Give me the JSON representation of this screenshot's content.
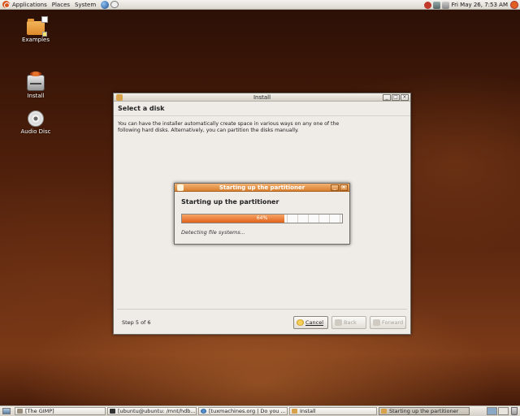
{
  "top_panel": {
    "menus": [
      "Applications",
      "Places",
      "System"
    ],
    "clock": "Fri May 26,  7:53 AM"
  },
  "desktop_icons": [
    {
      "label": "Examples"
    },
    {
      "label": "Install"
    },
    {
      "label": "Audio Disc"
    }
  ],
  "install_window": {
    "title": "Install",
    "heading": "Select a disk",
    "description": "You can have the installer automatically create space in various ways on any one of the following hard disks. Alternatively, you can partition the disks manually.",
    "step": "Step 5 of 6",
    "buttons": {
      "cancel": "Cancel",
      "back": "Back",
      "forward": "Forward"
    }
  },
  "progress_dialog": {
    "title": "Starting up the partitioner",
    "heading": "Starting up the partitioner",
    "progress_percent": 64,
    "progress_text": "64%",
    "status": "Detecting file systems..."
  },
  "taskbar": {
    "tasks": [
      {
        "label": "[The GIMP]"
      },
      {
        "label": "[ubuntu@ubuntu: /mnt/hdb..."
      },
      {
        "label": "[tuxmachines.org | Do you ..."
      },
      {
        "label": "Install"
      },
      {
        "label": "Starting up the partitioner"
      }
    ]
  },
  "colors": {
    "accent": "#e0621c",
    "dialog_title": "#d9802e"
  }
}
